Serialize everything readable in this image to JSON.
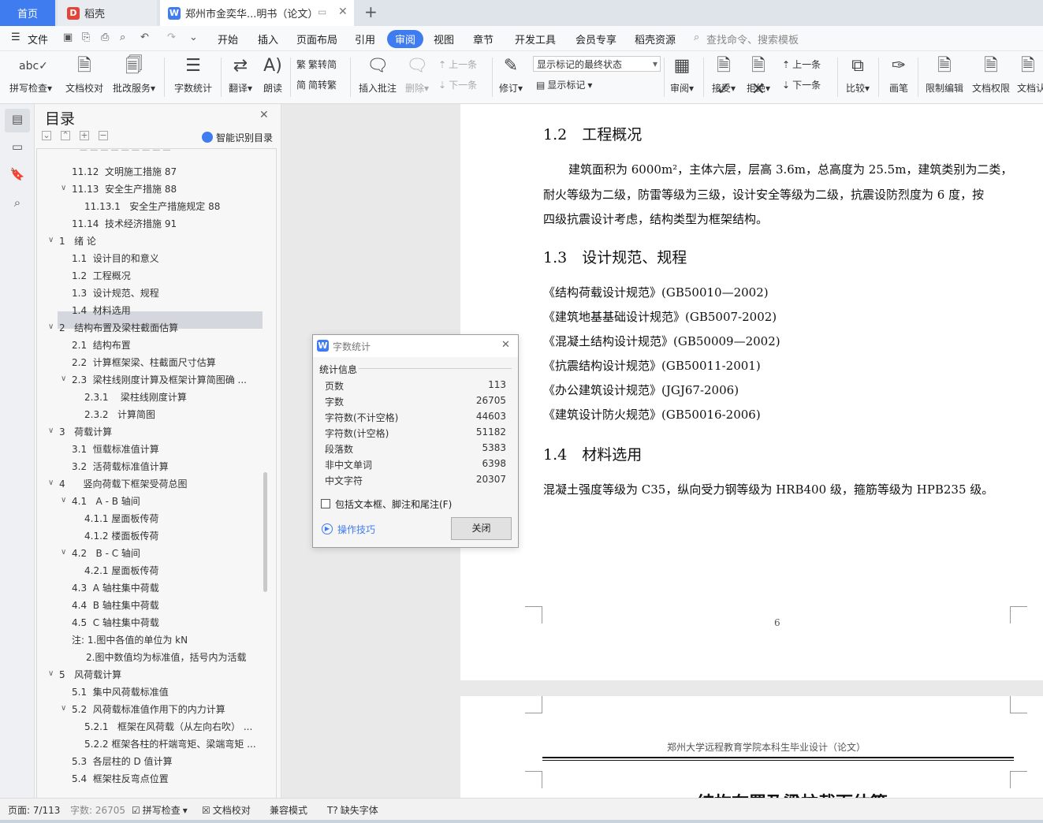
{
  "tabs": {
    "home": "首页",
    "daoke": "稻壳",
    "doc": "郑州市金奕华...明书（论文）",
    "new_tab": "+"
  },
  "menu": {
    "file": "文件",
    "items": [
      "开始",
      "插入",
      "页面布局",
      "引用",
      "审阅",
      "视图",
      "章节",
      "开发工具",
      "会员专享",
      "稻壳资源"
    ],
    "search": "查找命令、搜索模板"
  },
  "ribbon": {
    "spellcheck": "拼写检查",
    "doc_proof": "文档校对",
    "revise_service": "批改服务",
    "word_count": "字数统计",
    "translate": "翻译",
    "read_aloud": "朗读",
    "to_traditional": "繁转简",
    "to_simplified": "简转繁",
    "insert_comment": "插入批注",
    "delete": "删除",
    "prev_comment": "上一条",
    "next_comment": "下一条",
    "track": "修订",
    "markup_select": "显示标记的最终状态",
    "show_markup": "显示标记",
    "review": "审阅",
    "accept": "接受",
    "reject": "拒绝",
    "prev_change": "上一条",
    "next_change": "下一条",
    "compare": "比较",
    "pen": "画笔",
    "restrict_edit": "限制编辑",
    "doc_permission": "文档权限",
    "doc_cert": "文档认"
  },
  "toc": {
    "title": "目录",
    "smart": "智能识别目录",
    "items": [
      {
        "num": "11.12",
        "text": "文明施工措施 87"
      },
      {
        "num": "11.13",
        "text": "安全生产措施 88"
      },
      {
        "num": "11.13.1",
        "text": "安全生产措施规定 88"
      },
      {
        "num": "11.14",
        "text": "技术经济措施 91"
      },
      {
        "num": "1",
        "text": "绪 论"
      },
      {
        "num": "1.1",
        "text": "设计目的和意义"
      },
      {
        "num": "1.2",
        "text": "工程概况"
      },
      {
        "num": "1.3",
        "text": "设计规范、规程"
      },
      {
        "num": "1.4",
        "text": "材料选用"
      },
      {
        "num": "2",
        "text": "结构布置及梁柱截面估算"
      },
      {
        "num": "2.1",
        "text": "结构布置"
      },
      {
        "num": "2.2",
        "text": "计算框架梁、柱截面尺寸估算"
      },
      {
        "num": "2.3",
        "text": "梁柱线刚度计算及框架计算简图确 ..."
      },
      {
        "num": "2.3.1",
        "text": "梁柱线刚度计算"
      },
      {
        "num": "2.3.2",
        "text": "计算简图"
      },
      {
        "num": "3",
        "text": "荷载计算"
      },
      {
        "num": "3.1",
        "text": "恒载标准值计算"
      },
      {
        "num": "3.2",
        "text": "活荷载标准值计算"
      },
      {
        "num": "4",
        "text": "竖向荷载下框架受荷总图"
      },
      {
        "num": "4.1",
        "text": "A - B 轴间"
      },
      {
        "num": "4.1.1",
        "text": "屋面板传荷"
      },
      {
        "num": "4.1.2",
        "text": "楼面板传荷"
      },
      {
        "num": "4.2",
        "text": "B - C 轴间"
      },
      {
        "num": "4.2.1",
        "text": "屋面板传荷"
      },
      {
        "num": "4.3",
        "text": "A 轴柱集中荷载"
      },
      {
        "num": "4.4",
        "text": "B 轴柱集中荷载"
      },
      {
        "num": "4.5",
        "text": "C 轴柱集中荷载"
      },
      {
        "num": "注:",
        "text": "1.图中各值的单位为 kN"
      },
      {
        "num": "",
        "text": "2.图中数值均为标准值，括号内为活载"
      },
      {
        "num": "5",
        "text": "风荷载计算"
      },
      {
        "num": "5.1",
        "text": "集中风荷载标准值"
      },
      {
        "num": "5.2",
        "text": "风荷载标准值作用下的内力计算"
      },
      {
        "num": "5.2.1",
        "text": "框架在风荷载（从左向右吹） ..."
      },
      {
        "num": "5.2.2",
        "text": "框架各柱的杆端弯矩、梁端弯矩 ..."
      },
      {
        "num": "5.3",
        "text": "各层柱的 D 值计算"
      },
      {
        "num": "5.4",
        "text": "框架柱反弯点位置"
      }
    ]
  },
  "document": {
    "h12": "1.2　工程概况",
    "p12_lines": [
      "建筑面积为 6000m²，主体六层，层高 3.6m，总高度为 25.5m，建筑类别为二类，",
      "耐火等级为二级，防雷等级为三级，设计安全等级为二级，抗震设防烈度为 6 度，按",
      "四级抗震设计考虑，结构类型为框架结构。"
    ],
    "h13": "1.3　设计规范、规程",
    "codes": [
      "《结构荷载设计规范》(GB50010—2002)",
      "《建筑地基基础设计规范》(GB5007-2002)",
      "《混凝土结构设计规范》(GB50009—2002)",
      "《抗震结构设计规范》(GB50011-2001)",
      "《办公建筑设计规范》(JGJ67-2006)",
      "《建筑设计防火规范》(GB50016-2006)"
    ],
    "h14": "1.4　材料选用",
    "p14": "混凝土强度等级为 C35，纵向受力钢等级为 HRB400 级，箍筋等级为 HPB235 级。",
    "page_number": "6",
    "next_header": "郑州大学远程教育学院本科生毕业设计（论文）",
    "next_heading": "结构布置及梁柱截面估算"
  },
  "dialog": {
    "title": "字数统计",
    "section": "统计信息",
    "rows": [
      {
        "k": "页数",
        "v": "113"
      },
      {
        "k": "字数",
        "v": "26705"
      },
      {
        "k": "字符数(不计空格)",
        "v": "44603"
      },
      {
        "k": "字符数(计空格)",
        "v": "51182"
      },
      {
        "k": "段落数",
        "v": "5383"
      },
      {
        "k": "非中文单词",
        "v": "6398"
      },
      {
        "k": "中文字符",
        "v": "20307"
      }
    ],
    "checkbox": "包括文本框、脚注和尾注(F)",
    "tips": "操作技巧",
    "close": "关闭"
  },
  "status": {
    "page": "页面: 7/113",
    "words": "字数: 26705",
    "spell": "拼写检查",
    "proof": "文档校对",
    "compat": "兼容模式",
    "missing_font": "缺失字体"
  },
  "colors": {
    "accent": "#3f7cf0",
    "wps_red": "#e2443a"
  }
}
